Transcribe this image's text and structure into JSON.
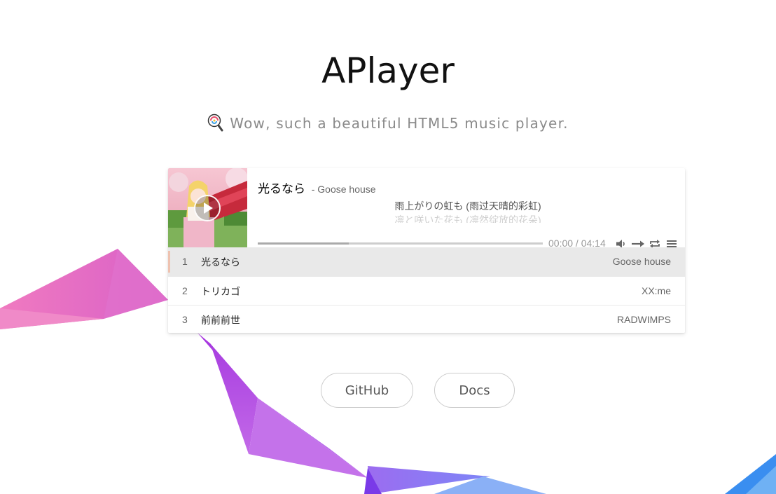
{
  "header": {
    "title": "APlayer",
    "subtitle": "Wow, such a beautiful HTML5 music player."
  },
  "player": {
    "now_playing": {
      "title": "光るなら",
      "author": "- Goose house"
    },
    "lyrics": {
      "current": "雨上がりの虹も (雨过天晴的彩虹)",
      "next": "凛と咲いた花も (凛然绽放的花朵)"
    },
    "progress": {
      "played_fraction": 0.0,
      "loaded_fraction": 0.32
    },
    "time": "00:00 / 04:14",
    "controls": [
      "volume-icon",
      "order-icon",
      "loop-icon",
      "menu-icon"
    ],
    "playlist": [
      {
        "index": "1",
        "name": "光るなら",
        "artist": "Goose house"
      },
      {
        "index": "2",
        "name": "トリカゴ",
        "artist": "XX:me"
      },
      {
        "index": "3",
        "name": "前前前世",
        "artist": "RADWIMPS"
      }
    ],
    "active_index": 0
  },
  "links": {
    "github": "GitHub",
    "docs": "Docs"
  },
  "colors": {
    "active_marker": "#eec2b0",
    "active_row": "#e9e9e9",
    "polygon_pink": "#e86bc5",
    "polygon_purple": "#b860e8",
    "polygon_blue": "#6e7cf5"
  }
}
